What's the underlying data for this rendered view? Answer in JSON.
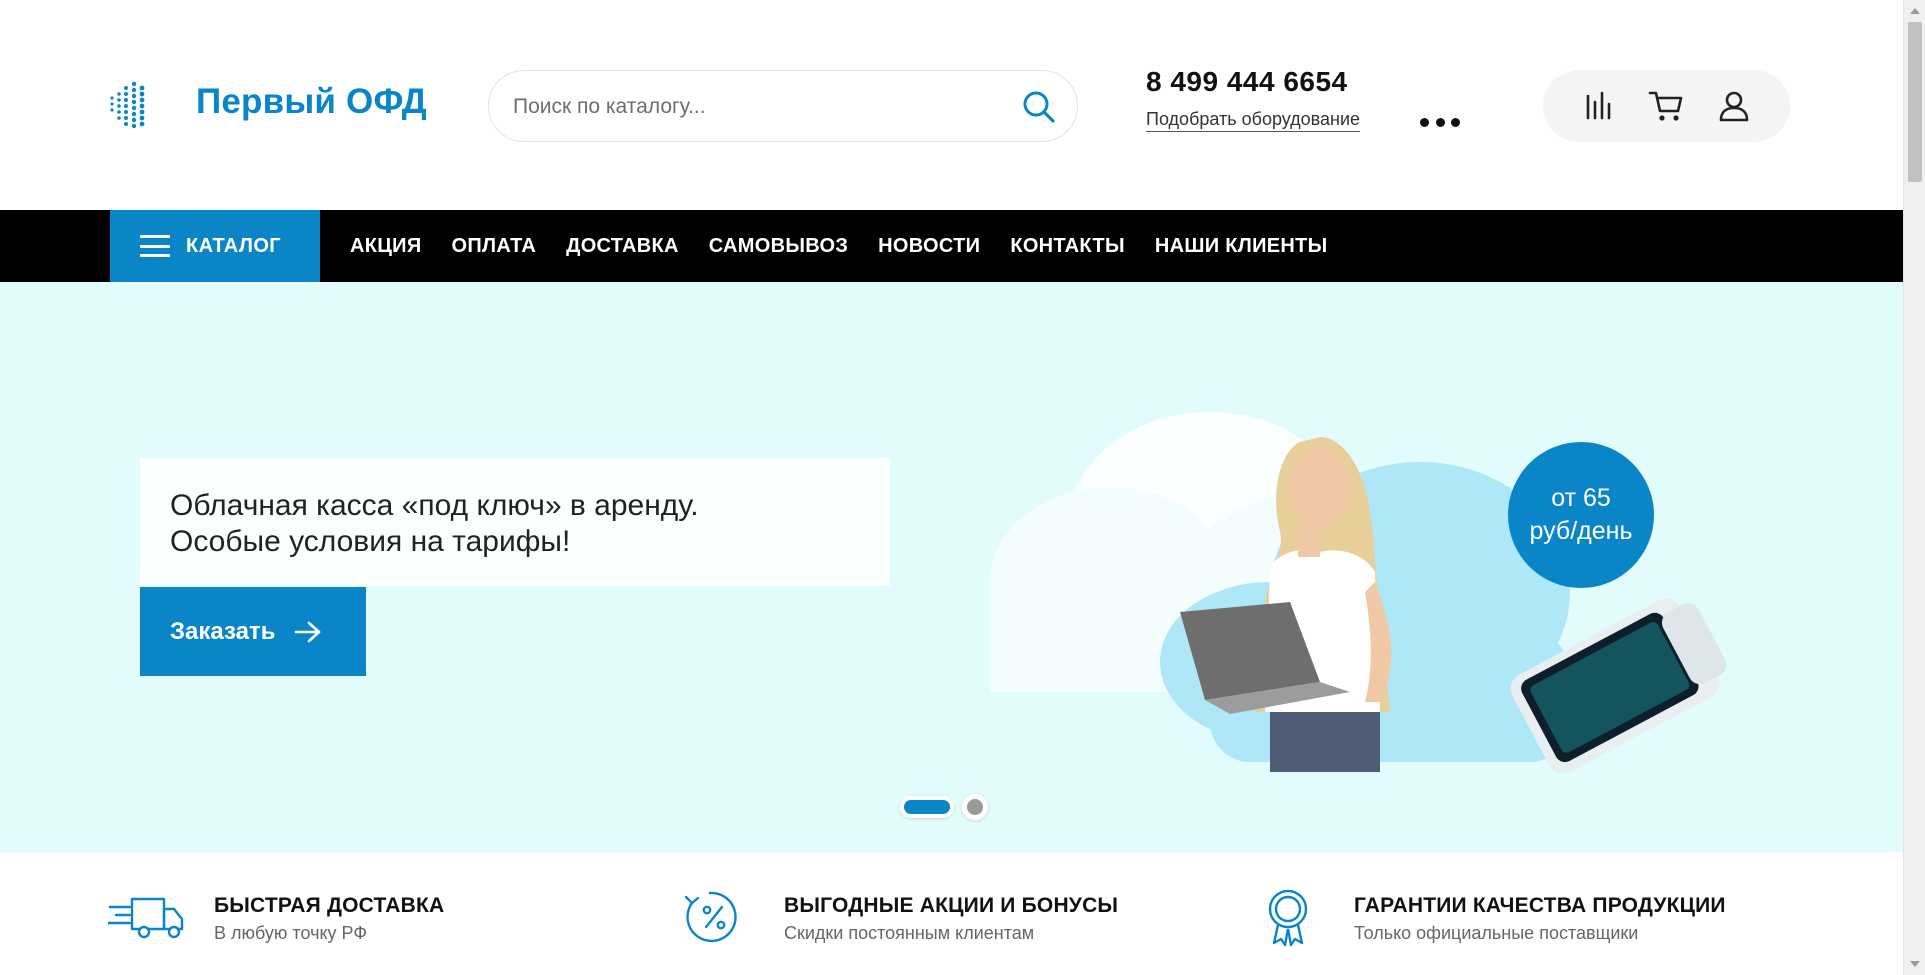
{
  "header": {
    "logo_text": "Первый ОФД",
    "search_placeholder": "Поиск по каталогу...",
    "phone": "8 499 444 6654",
    "pick_equipment": "Подобрать оборудование"
  },
  "nav": {
    "catalog_label": "КАТАЛОГ",
    "items": [
      "АКЦИЯ",
      "ОПЛАТА",
      "ДОСТАВКА",
      "САМОВЫВОЗ",
      "НОВОСТИ",
      "КОНТАКТЫ",
      "НАШИ КЛИЕНТЫ"
    ]
  },
  "banner": {
    "line1": "Облачная касса «под ключ» в аренду.",
    "line2": "Особые условия на тарифы!",
    "button_label": "Заказать",
    "price_line1": "от 65",
    "price_line2": "руб/день",
    "slides_total": 2,
    "active_slide": 1
  },
  "features": [
    {
      "title": "БЫСТРАЯ ДОСТАВКА",
      "subtitle": "В любую точку РФ",
      "icon": "truck-icon"
    },
    {
      "title": "ВЫГОДНЫЕ АКЦИИ И БОНУСЫ",
      "subtitle": "Скидки постоянным клиентам",
      "icon": "percent-icon"
    },
    {
      "title": "ГАРАНТИИ КАЧЕСТВА ПРОДУКЦИИ",
      "subtitle": "Только официальные поставщики",
      "icon": "award-icon"
    }
  ],
  "colors": {
    "accent": "#0a86c8",
    "nav_bg": "#000000",
    "banner_bg": "#e2fbfd"
  }
}
